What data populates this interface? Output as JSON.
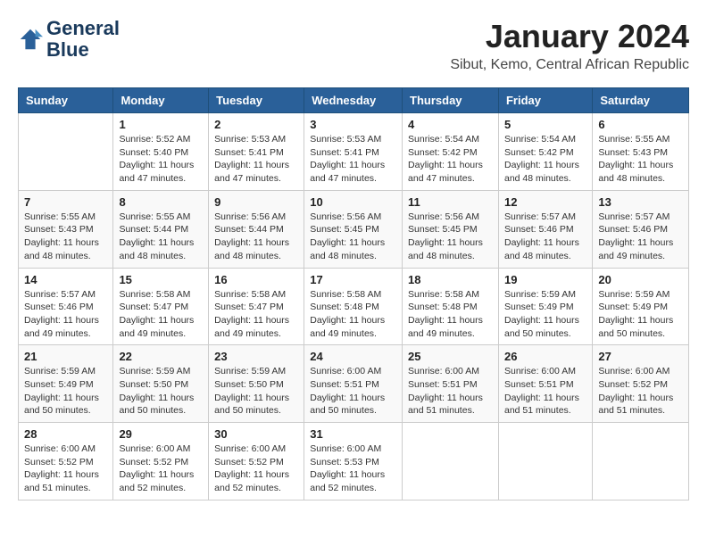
{
  "logo": {
    "line1": "General",
    "line2": "Blue"
  },
  "title": "January 2024",
  "location": "Sibut, Kemo, Central African Republic",
  "weekdays": [
    "Sunday",
    "Monday",
    "Tuesday",
    "Wednesday",
    "Thursday",
    "Friday",
    "Saturday"
  ],
  "weeks": [
    [
      {
        "day": "",
        "info": ""
      },
      {
        "day": "1",
        "info": "Sunrise: 5:52 AM\nSunset: 5:40 PM\nDaylight: 11 hours\nand 47 minutes."
      },
      {
        "day": "2",
        "info": "Sunrise: 5:53 AM\nSunset: 5:41 PM\nDaylight: 11 hours\nand 47 minutes."
      },
      {
        "day": "3",
        "info": "Sunrise: 5:53 AM\nSunset: 5:41 PM\nDaylight: 11 hours\nand 47 minutes."
      },
      {
        "day": "4",
        "info": "Sunrise: 5:54 AM\nSunset: 5:42 PM\nDaylight: 11 hours\nand 47 minutes."
      },
      {
        "day": "5",
        "info": "Sunrise: 5:54 AM\nSunset: 5:42 PM\nDaylight: 11 hours\nand 48 minutes."
      },
      {
        "day": "6",
        "info": "Sunrise: 5:55 AM\nSunset: 5:43 PM\nDaylight: 11 hours\nand 48 minutes."
      }
    ],
    [
      {
        "day": "7",
        "info": "Sunrise: 5:55 AM\nSunset: 5:43 PM\nDaylight: 11 hours\nand 48 minutes."
      },
      {
        "day": "8",
        "info": "Sunrise: 5:55 AM\nSunset: 5:44 PM\nDaylight: 11 hours\nand 48 minutes."
      },
      {
        "day": "9",
        "info": "Sunrise: 5:56 AM\nSunset: 5:44 PM\nDaylight: 11 hours\nand 48 minutes."
      },
      {
        "day": "10",
        "info": "Sunrise: 5:56 AM\nSunset: 5:45 PM\nDaylight: 11 hours\nand 48 minutes."
      },
      {
        "day": "11",
        "info": "Sunrise: 5:56 AM\nSunset: 5:45 PM\nDaylight: 11 hours\nand 48 minutes."
      },
      {
        "day": "12",
        "info": "Sunrise: 5:57 AM\nSunset: 5:46 PM\nDaylight: 11 hours\nand 48 minutes."
      },
      {
        "day": "13",
        "info": "Sunrise: 5:57 AM\nSunset: 5:46 PM\nDaylight: 11 hours\nand 49 minutes."
      }
    ],
    [
      {
        "day": "14",
        "info": "Sunrise: 5:57 AM\nSunset: 5:46 PM\nDaylight: 11 hours\nand 49 minutes."
      },
      {
        "day": "15",
        "info": "Sunrise: 5:58 AM\nSunset: 5:47 PM\nDaylight: 11 hours\nand 49 minutes."
      },
      {
        "day": "16",
        "info": "Sunrise: 5:58 AM\nSunset: 5:47 PM\nDaylight: 11 hours\nand 49 minutes."
      },
      {
        "day": "17",
        "info": "Sunrise: 5:58 AM\nSunset: 5:48 PM\nDaylight: 11 hours\nand 49 minutes."
      },
      {
        "day": "18",
        "info": "Sunrise: 5:58 AM\nSunset: 5:48 PM\nDaylight: 11 hours\nand 49 minutes."
      },
      {
        "day": "19",
        "info": "Sunrise: 5:59 AM\nSunset: 5:49 PM\nDaylight: 11 hours\nand 50 minutes."
      },
      {
        "day": "20",
        "info": "Sunrise: 5:59 AM\nSunset: 5:49 PM\nDaylight: 11 hours\nand 50 minutes."
      }
    ],
    [
      {
        "day": "21",
        "info": "Sunrise: 5:59 AM\nSunset: 5:49 PM\nDaylight: 11 hours\nand 50 minutes."
      },
      {
        "day": "22",
        "info": "Sunrise: 5:59 AM\nSunset: 5:50 PM\nDaylight: 11 hours\nand 50 minutes."
      },
      {
        "day": "23",
        "info": "Sunrise: 5:59 AM\nSunset: 5:50 PM\nDaylight: 11 hours\nand 50 minutes."
      },
      {
        "day": "24",
        "info": "Sunrise: 6:00 AM\nSunset: 5:51 PM\nDaylight: 11 hours\nand 50 minutes."
      },
      {
        "day": "25",
        "info": "Sunrise: 6:00 AM\nSunset: 5:51 PM\nDaylight: 11 hours\nand 51 minutes."
      },
      {
        "day": "26",
        "info": "Sunrise: 6:00 AM\nSunset: 5:51 PM\nDaylight: 11 hours\nand 51 minutes."
      },
      {
        "day": "27",
        "info": "Sunrise: 6:00 AM\nSunset: 5:52 PM\nDaylight: 11 hours\nand 51 minutes."
      }
    ],
    [
      {
        "day": "28",
        "info": "Sunrise: 6:00 AM\nSunset: 5:52 PM\nDaylight: 11 hours\nand 51 minutes."
      },
      {
        "day": "29",
        "info": "Sunrise: 6:00 AM\nSunset: 5:52 PM\nDaylight: 11 hours\nand 52 minutes."
      },
      {
        "day": "30",
        "info": "Sunrise: 6:00 AM\nSunset: 5:52 PM\nDaylight: 11 hours\nand 52 minutes."
      },
      {
        "day": "31",
        "info": "Sunrise: 6:00 AM\nSunset: 5:53 PM\nDaylight: 11 hours\nand 52 minutes."
      },
      {
        "day": "",
        "info": ""
      },
      {
        "day": "",
        "info": ""
      },
      {
        "day": "",
        "info": ""
      }
    ]
  ]
}
